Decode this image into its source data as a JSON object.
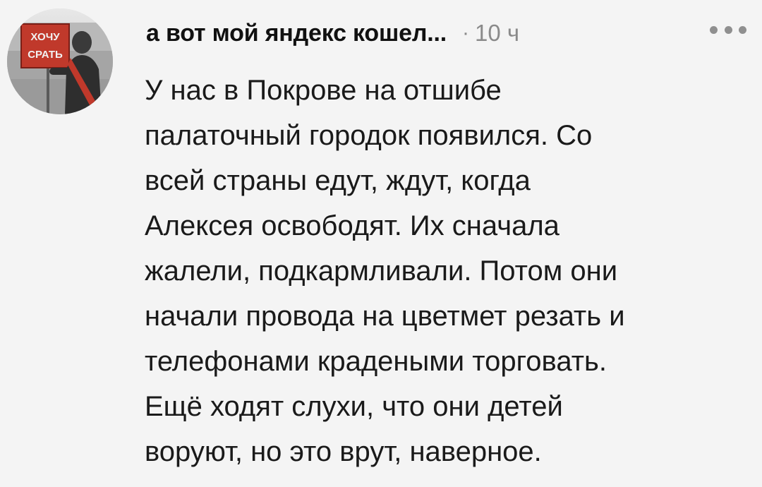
{
  "comment": {
    "author": "а вот мой яндекс кошел...",
    "separator": "·",
    "time": "10 ч",
    "avatar": {
      "sign_text": [
        "ХОЧУ",
        "СРАТЬ"
      ]
    },
    "text_lines": [
      "У нас в Покрове на отшибе",
      "палаточный городок появился. Со",
      "всей страны едут, ждут, когда",
      "Алексея освободят. Их сначала",
      "жалели, подкармливали. Потом они",
      "начали провода на цветмет резать и",
      "телефонами крадеными торговать.",
      "Ещё ходят слухи, что они детей",
      "воруют, но это врут, наверное."
    ]
  }
}
